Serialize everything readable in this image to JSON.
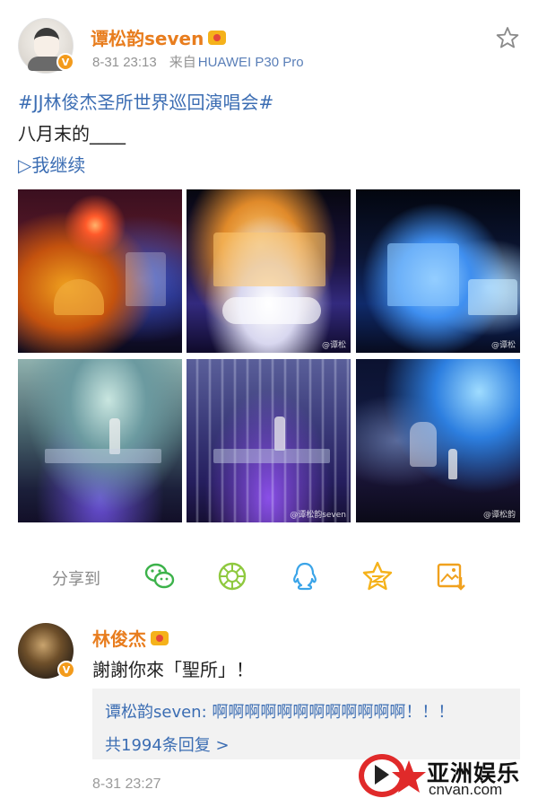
{
  "post": {
    "username": "谭松韵seven",
    "date": "8-31 23:13",
    "source_prefix": "来自",
    "device": "HUAWEI P30 Pro",
    "hashtag": "#JJ林俊杰圣所世界巡回演唱会#",
    "text": "八月末的____",
    "continue_link": "▷我继续",
    "verified_badge": "V",
    "photos": [
      {
        "watermark": ""
      },
      {
        "watermark": "@谭松"
      },
      {
        "watermark": "@谭松"
      },
      {
        "watermark": ""
      },
      {
        "watermark": "@谭松韵seven"
      },
      {
        "watermark": "@谭松韵"
      }
    ]
  },
  "share": {
    "label": "分享到",
    "icons": [
      "wechat-icon",
      "moments-icon",
      "qq-icon",
      "qzone-icon",
      "save-image-icon"
    ],
    "colors": {
      "wechat": "#3cb24a",
      "moments": "#8fc93f",
      "qq": "#3aa4e8",
      "qzone": "#f5b21b",
      "save": "#f0a11e"
    }
  },
  "comment": {
    "username": "林俊杰",
    "text": "謝謝你來「聖所」！",
    "reply_user": "谭松韵seven:",
    "reply_text": " 啊啊啊啊啊啊啊啊啊啊啊啊！！！",
    "reply_more": "共1994条回复 >",
    "time": "8-31 23:27"
  },
  "watermark_logo": {
    "name": "亚洲娱乐",
    "url": "cnvan.com"
  },
  "colors": {
    "username": "#e87d1e",
    "link": "#3b6db3",
    "verified": "#f39b1c",
    "logo_red": "#e02a2a"
  }
}
